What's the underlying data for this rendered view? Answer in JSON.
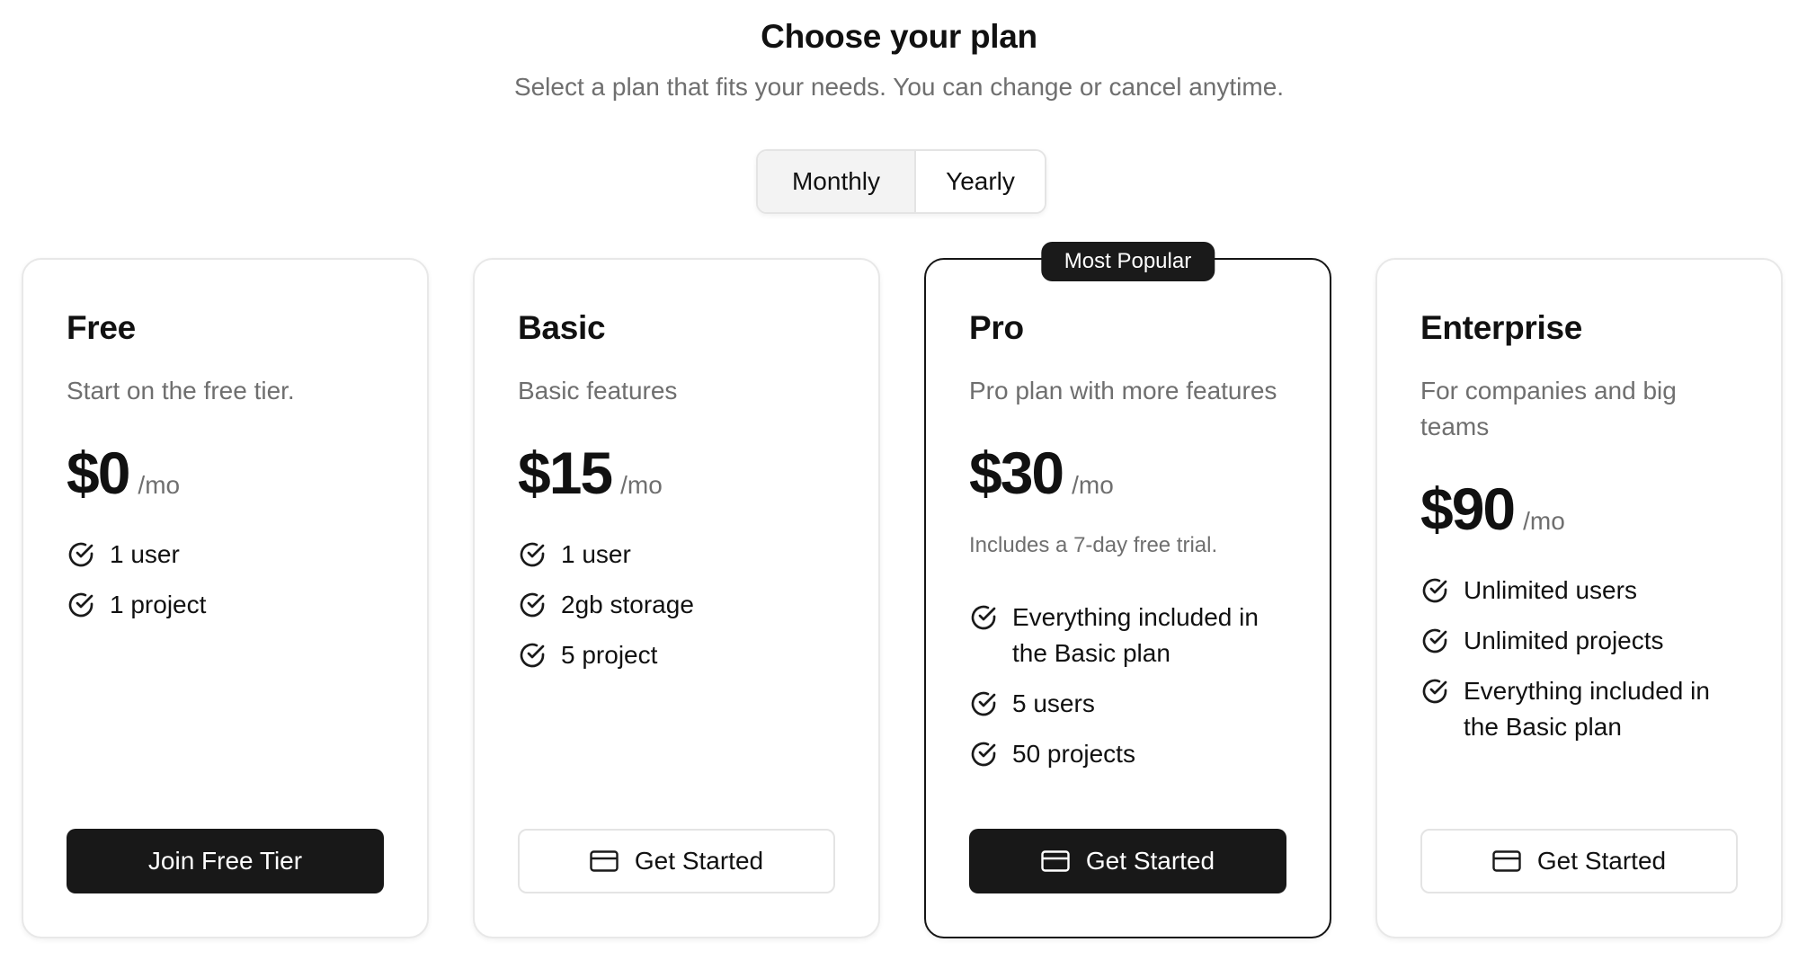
{
  "header": {
    "title": "Choose your plan",
    "subtitle": "Select a plan that fits your needs. You can change or cancel anytime."
  },
  "billing_toggle": {
    "options": [
      "Monthly",
      "Yearly"
    ],
    "selected": "Monthly"
  },
  "plans": [
    {
      "name": "Free",
      "description": "Start on the free tier.",
      "price": "$0",
      "period": "/mo",
      "features": [
        "1 user",
        "1 project"
      ],
      "button": {
        "label": "Join Free Tier",
        "icon": "none"
      }
    },
    {
      "name": "Basic",
      "description": "Basic features",
      "price": "$15",
      "period": "/mo",
      "features": [
        "1 user",
        "2gb storage",
        "5 project"
      ],
      "button": {
        "label": "Get Started",
        "icon": "credit-card-icon"
      }
    },
    {
      "name": "Pro",
      "badge": "Most Popular",
      "description": "Pro plan with more features",
      "price": "$30",
      "period": "/mo",
      "note": "Includes a 7-day free trial.",
      "features": [
        "Everything included in the Basic plan",
        "5 users",
        "50 projects"
      ],
      "button": {
        "label": "Get Started",
        "icon": "credit-card-icon"
      }
    },
    {
      "name": "Enterprise",
      "description": "For companies and big teams",
      "price": "$90",
      "period": "/mo",
      "features": [
        "Unlimited users",
        "Unlimited projects",
        "Everything included in the Basic plan"
      ],
      "button": {
        "label": "Get Started",
        "icon": "credit-card-icon"
      }
    }
  ],
  "colors": {
    "primary": "#181818",
    "muted_text": "#6f6f6f",
    "border": "#e4e4e4"
  }
}
